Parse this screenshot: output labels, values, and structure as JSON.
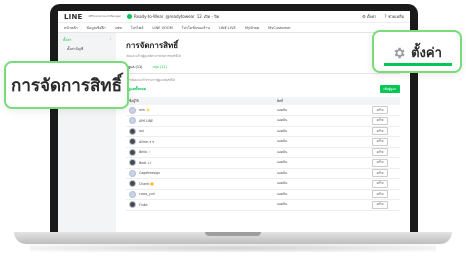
{
  "topbar": {
    "brand": "LINE",
    "brand_sub": "Official Account Manager",
    "account_name": "Ready-to-Wear",
    "account_id": "@readytowear",
    "stats": "12",
    "status": "เปิด - ปิด",
    "user": "ตั้งค่า",
    "help": "ช่วยเหลือ"
  },
  "nav": [
    "หน้าหลัก",
    "ข้อมูลเชิงลึก",
    "แชท",
    "โปรไฟล์",
    "LINE VOOM",
    "โปรโมชั่นของร้าน",
    "LINE LIVE",
    "MyShop",
    "MyCustomer"
  ],
  "sidenav": {
    "head": "ตั้งค่า",
    "item": "ตั้งค่าบัญชี"
  },
  "page": {
    "title": "การจัดการสิทธิ์",
    "desc": "เพิ่มและแก้ไขผู้ดูแลที่สามารถจัดการบัญชีนี้ได้",
    "tabs": [
      "ผู้ดูแล (11)",
      "กลุ่ม (11)"
    ],
    "note": "การเพิ่มและแก้ไขรายการผู้ดูแลบัญชีนี้ได้",
    "section": "ผู้ดูแลทั้งหมด",
    "add_button": "เพิ่มผู้ดูแล",
    "col_name": "ชื่อผู้ใช้",
    "col_role": "สิทธิ์",
    "edit_label": "แก้ไข"
  },
  "rows": [
    {
      "name": "aim ⭐",
      "role": "แอดมิน"
    },
    {
      "name": "AIM LINE",
      "role": "แอดมิน"
    },
    {
      "name": "aoi",
      "role": "แอดมิน"
    },
    {
      "name": "Allme.✦✦",
      "role": "แอดมิน"
    },
    {
      "name": "Bella ♡",
      "role": "แอดมิน"
    },
    {
      "name": "Boat ♪♪",
      "role": "แอดมิน"
    },
    {
      "name": "Cagefreesign",
      "role": "แอดมิน"
    },
    {
      "name": "Chanti 🌼",
      "role": "แอดมิน"
    },
    {
      "name": "cross_yuri",
      "role": "แอดมิน"
    },
    {
      "name": "Fluke",
      "role": "แอดมิน"
    }
  ],
  "callouts": {
    "left": "การจัดการสิทธิ์",
    "right": "ตั้งค่า"
  },
  "colors": {
    "accent": "#06c755",
    "callout_border": "#78dc78"
  }
}
